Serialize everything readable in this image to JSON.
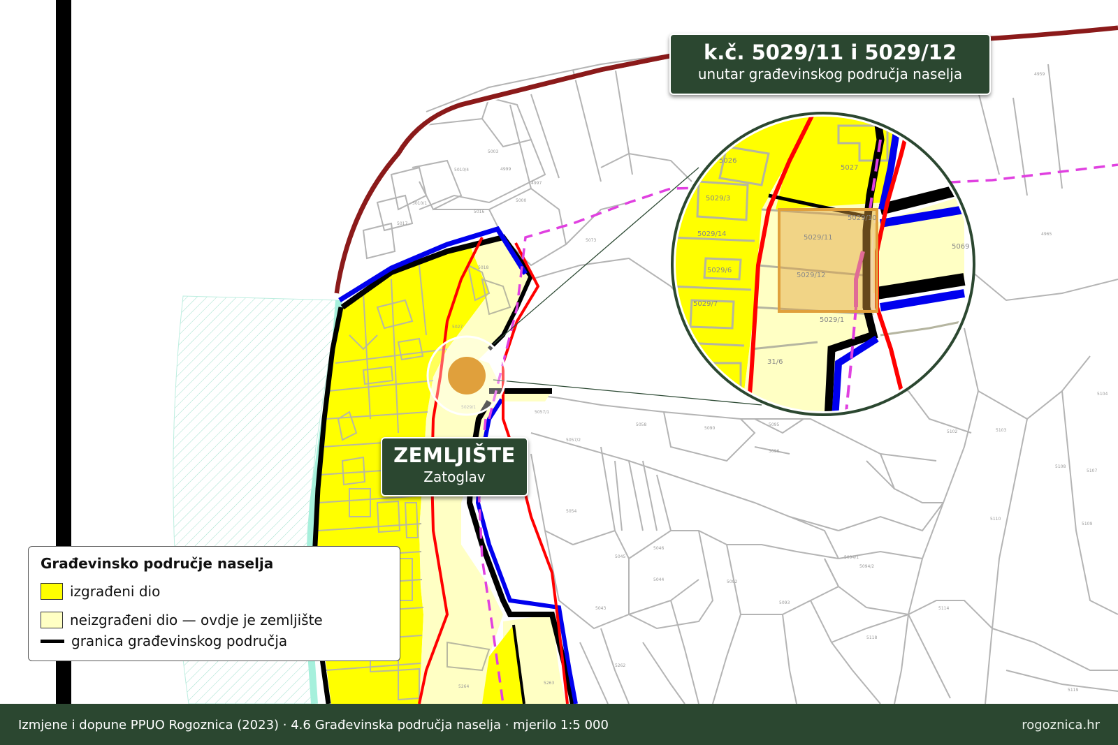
{
  "map": {
    "main_label": {
      "title": "ZEMLJIŠTE",
      "subtitle": "Zatoglav"
    },
    "parcel_label": {
      "title": "k.č. 5029/11 i 5029/12",
      "subtitle": "unutar građevinskog područja naselja"
    },
    "legend": {
      "title": "Građevinsko područje naselja",
      "items": [
        {
          "label": "izgrađeni dio",
          "color": "#ffff00"
        },
        {
          "label": "neizgrađeni dio  — ovdje je zemljište",
          "color": "#ffffc4"
        },
        {
          "label": "granica građevinskog područja",
          "color": "#000000"
        }
      ]
    },
    "zoom_parcels": [
      "5027",
      "5026",
      "5029/3",
      "5029/14",
      "5029/6",
      "5029/7",
      "5029/11",
      "5029/12",
      "5029/10",
      "5029/1",
      "5069",
      "31/6"
    ],
    "parcel_numbers": [
      "4959",
      "4965",
      "4999",
      "4997",
      "5000",
      "5003",
      "5010/4",
      "5010/1",
      "5016",
      "5017",
      "5018",
      "5027",
      "5029/1",
      "5057/1",
      "5057/2",
      "5058",
      "5090",
      "5095",
      "5096",
      "5093",
      "5092",
      "5094/2",
      "5094/1",
      "5102",
      "5103",
      "5104",
      "5107",
      "5108",
      "5109",
      "5110",
      "5114",
      "5118",
      "5119",
      "5264",
      "5263",
      "5262",
      "5044",
      "5045",
      "5046",
      "5043",
      "5054",
      "5073"
    ],
    "colors": {
      "built": "#ffff00",
      "unbuilt": "#ffffc4",
      "boundary": "#000000",
      "red_line": "#ff0000",
      "blue_line": "#0000ee",
      "dark_red_coast": "#8b1a1a",
      "magenta_dash": "#e040e0",
      "marker": "#e0a03c",
      "panel": "#2b4730"
    }
  },
  "footer": {
    "left": "Izmjene i dopune PPUO Rogoznica (2023)   ·   4.6 Građevinska područja naselja   ·   mjerilo 1:5 000",
    "right": "rogoznica.hr"
  }
}
